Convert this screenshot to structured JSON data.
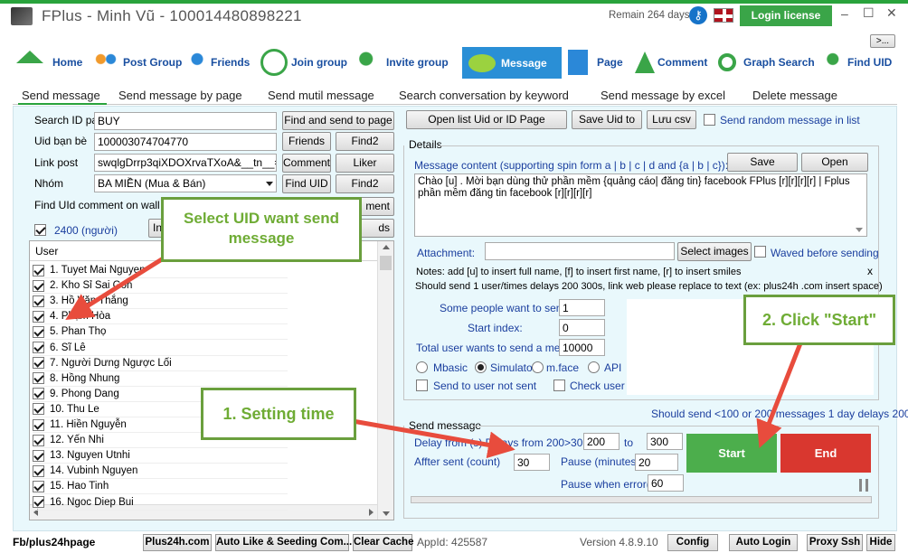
{
  "titlebar": {
    "title": "FPlus - Minh Vũ - 100014480898221",
    "remain": "Remain 264 days",
    "login": "Login license",
    "minimize": "–",
    "maximize": "☐",
    "close": "✕"
  },
  "overflow": ">...",
  "nav": [
    {
      "label": "Home"
    },
    {
      "label": "Post Group"
    },
    {
      "label": "Friends"
    },
    {
      "label": "Join group"
    },
    {
      "label": "Invite group"
    },
    {
      "label": "Message"
    },
    {
      "label": "Page"
    },
    {
      "label": "Comment"
    },
    {
      "label": "Graph Search"
    },
    {
      "label": "Find UID"
    }
  ],
  "tabs": [
    "Send message",
    "Send message by page",
    "Send mutil message",
    "Search conversation by keyword",
    "Send message by excel",
    "Delete message"
  ],
  "left": {
    "search_label": "Search ID pag",
    "search_value": "BUY",
    "find_send_btn": "Find and send to page",
    "uid_label": "Uid bạn bè",
    "uid_value": "100003074704770",
    "friends_btn": "Friends",
    "find2a_btn": "Find2",
    "link_label": "Link post",
    "link_value": "swqlgDrrp3qiXDOXrvaTXoA&__tn__=H-R",
    "comment_btn": "Comment",
    "liker_btn": "Liker",
    "group_label": "Nhóm",
    "group_value": "BA MIỀN (Mua & Bán)",
    "findUID_btn": "Find UID",
    "find2b_btn": "Find2",
    "findwall_label": "Find UId comment on wall (co",
    "ment_btn": "ment",
    "count_label": "2400 (người)",
    "in_btn": "In",
    "ds_btn": "ds",
    "user_header": "User",
    "users": [
      "1. Tuyet Mai Nguyen",
      "2. Kho Sỉ Sai Gon",
      "3. Hồ Văn Thắng",
      "4. Phạm Hòa",
      "5. Phan Thọ",
      "6. Sĩ Lê",
      "7. Người Dưng Ngược Lối",
      "8. Hồng Nhung",
      "9. Phong Dang",
      "10. Thu Le",
      "11. Hiền Nguyễn",
      "12. Yến Nhi",
      "13. Nguyen Utnhi",
      "14. Vubinh Nguyen",
      "15. Hao Tinh",
      "16. Ngoc Diep Bui"
    ]
  },
  "right": {
    "open_list_btn": "Open list Uid or ID Page",
    "save_uid_btn": "Save Uid to",
    "luu_csv_btn": "Lưu csv",
    "random_label": "Send random message in list",
    "details_label": "Details",
    "msg_content_label": "Message content (supporting spin form a | b | c | d and {a | b | c}):",
    "save_btn": "Save",
    "open_btn": "Open",
    "message_text": "Chào [u] . Mời bạn dùng thử phần mềm {quảng cáo| đăng tin} facebook FPlus [r][r][r][r] | Fplus phần mềm đăng tin facebook [r][r][r][r]",
    "attachment_label": "Attachment:",
    "select_images_btn": "Select images",
    "waved_label": "Waved before sending",
    "notes1": "Notes: add [u] to insert full name, [f] to insert first name, [r] to insert smiles",
    "notes2": "Should send 1 user/times delays 200 300s, link web please replace to text (ex: plus24h .com insert space)",
    "notes_close": "x",
    "some_people_label": "Some people want to send /",
    "some_people_value": "1",
    "start_index_label": "Start index:",
    "start_index_value": "0",
    "total_label": "Total user wants to send a messa",
    "total_value": "10000",
    "mbasic": "Mbasic",
    "simulator": "Simulator",
    "mface": "m.face",
    "api": "API",
    "not_sent_label": "Send to user not sent",
    "check_user_label": "Check user se",
    "should_send": "Should send <100 or 200 messages 1 day delays 200",
    "send_msg_label": "Send message",
    "delay_label": "Delay from (s) Delays from 200>30",
    "delay_from": "200",
    "to_label": "to",
    "delay_to": "300",
    "after_label": "Affter sent (count)",
    "after_value": "30",
    "pause_label": "Pause (minutes)",
    "pause_value": "20",
    "pause_err_label": "Pause when error(m)",
    "pause_err_value": "60",
    "start_btn": "Start",
    "end_btn": "End"
  },
  "callouts": {
    "select": "Select UID want send message",
    "setting": "1. Setting time",
    "click": "2. Click \"Start\""
  },
  "bottom": {
    "fb": "Fb/plus24hpage",
    "plus24h": "Plus24h.com",
    "autolike": "Auto Like & Seeding Com...",
    "clearcache": "Clear Cache",
    "appid": "AppId: 425587",
    "version": "Version 4.8.9.10",
    "config": "Config",
    "autologin": "Auto Login",
    "proxy": "Proxy Ssh",
    "hide": "Hide"
  },
  "colors": {
    "accent_green": "#29a33c",
    "start_green": "#4cae4c",
    "end_red": "#d9372f",
    "callout_border": "#6a9f3d",
    "arrow_red": "#e84c3d",
    "message_tab": "#2a8fd6"
  }
}
